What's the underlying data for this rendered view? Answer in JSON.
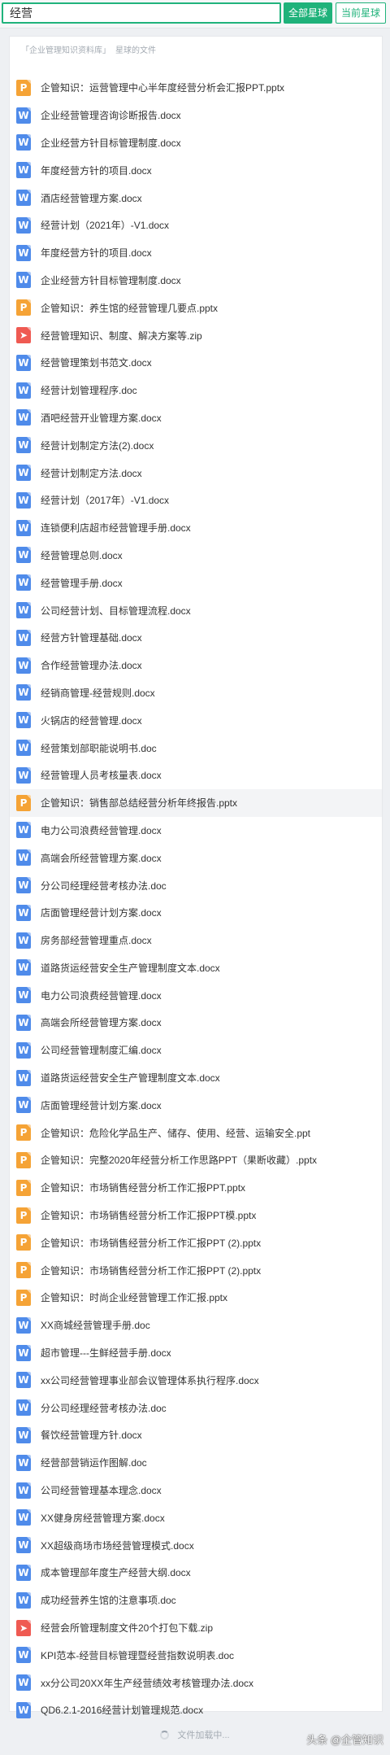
{
  "search": {
    "value": "经营",
    "all_button": "全部星球",
    "current_button": "当前星球"
  },
  "breadcrumb": {
    "items": [
      "企业管理知识资料库",
      "星球的文件"
    ],
    "prefix": "「",
    "separator": "」"
  },
  "colors": {
    "accent": "#1fb27a",
    "doc": "#4f8bea",
    "ppt": "#f5a336",
    "zip": "#ef5a52"
  },
  "files": [
    {
      "type": "ppt",
      "name": "企管知识：运营管理中心半年度经营分析会汇报PPT.pptx"
    },
    {
      "type": "doc",
      "name": "企业经营管理咨询诊断报告.docx"
    },
    {
      "type": "doc",
      "name": "企业经营方针目标管理制度.docx"
    },
    {
      "type": "doc",
      "name": "年度经营方针的项目.docx"
    },
    {
      "type": "doc",
      "name": "酒店经营管理方案.docx"
    },
    {
      "type": "doc",
      "name": "经营计划（2021年）-V1.docx"
    },
    {
      "type": "doc",
      "name": "年度经营方针的项目.docx"
    },
    {
      "type": "doc",
      "name": "企业经营方针目标管理制度.docx"
    },
    {
      "type": "ppt",
      "name": "企管知识：养生馆的经营管理几要点.pptx"
    },
    {
      "type": "zip",
      "name": "经营管理知识、制度、解决方案等.zip"
    },
    {
      "type": "doc",
      "name": "经营管理策划书范文.docx"
    },
    {
      "type": "doc",
      "name": "经营计划管理程序.doc"
    },
    {
      "type": "doc",
      "name": "酒吧经营开业管理方案.docx"
    },
    {
      "type": "doc",
      "name": "经营计划制定方法(2).docx"
    },
    {
      "type": "doc",
      "name": "经营计划制定方法.docx"
    },
    {
      "type": "doc",
      "name": "经营计划（2017年）-V1.docx"
    },
    {
      "type": "doc",
      "name": "连锁便利店超市经营管理手册.docx"
    },
    {
      "type": "doc",
      "name": "经营管理总则.docx"
    },
    {
      "type": "doc",
      "name": "经营管理手册.docx"
    },
    {
      "type": "doc",
      "name": "公司经营计划、目标管理流程.docx"
    },
    {
      "type": "doc",
      "name": "经营方针管理基础.docx"
    },
    {
      "type": "doc",
      "name": "合作经营管理办法.docx"
    },
    {
      "type": "doc",
      "name": "经销商管理-经营规则.docx"
    },
    {
      "type": "doc",
      "name": "火锅店的经营管理.docx"
    },
    {
      "type": "doc",
      "name": "经营策划部职能说明书.doc"
    },
    {
      "type": "doc",
      "name": "经营管理人员考核量表.docx"
    },
    {
      "type": "ppt",
      "name": "企管知识：销售部总结经营分析年终报告.pptx",
      "highlight": true
    },
    {
      "type": "doc",
      "name": "电力公司浪费经营管理.docx"
    },
    {
      "type": "doc",
      "name": "高端会所经营管理方案.docx"
    },
    {
      "type": "doc",
      "name": "分公司经理经营考核办法.doc"
    },
    {
      "type": "doc",
      "name": "店面管理经营计划方案.docx"
    },
    {
      "type": "doc",
      "name": "房务部经营管理重点.docx"
    },
    {
      "type": "doc",
      "name": "道路货运经营安全生产管理制度文本.docx"
    },
    {
      "type": "doc",
      "name": "电力公司浪费经营管理.docx"
    },
    {
      "type": "doc",
      "name": "高端会所经营管理方案.docx"
    },
    {
      "type": "doc",
      "name": "公司经营管理制度汇编.docx"
    },
    {
      "type": "doc",
      "name": "道路货运经营安全生产管理制度文本.docx"
    },
    {
      "type": "doc",
      "name": "店面管理经营计划方案.docx"
    },
    {
      "type": "ppt",
      "name": "企管知识：危险化学品生产、储存、使用、经营、运输安全.ppt"
    },
    {
      "type": "ppt",
      "name": "企管知识：完整2020年经营分析工作思路PPT（果断收藏）.pptx"
    },
    {
      "type": "ppt",
      "name": "企管知识：市场销售经营分析工作汇报PPT.pptx"
    },
    {
      "type": "ppt",
      "name": "企管知识：市场销售经营分析工作汇报PPT模.pptx"
    },
    {
      "type": "ppt",
      "name": "企管知识：市场销售经营分析工作汇报PPT (2).pptx"
    },
    {
      "type": "ppt",
      "name": "企管知识：市场销售经营分析工作汇报PPT (2).pptx"
    },
    {
      "type": "ppt",
      "name": "企管知识：时尚企业经营管理工作汇报.pptx"
    },
    {
      "type": "doc",
      "name": "XX商城经营管理手册.doc"
    },
    {
      "type": "doc",
      "name": "超市管理---生鲜经营手册.docx"
    },
    {
      "type": "doc",
      "name": "xx公司经营管理事业部会议管理体系执行程序.docx"
    },
    {
      "type": "doc",
      "name": "分公司经理经营考核办法.doc"
    },
    {
      "type": "doc",
      "name": "餐饮经营管理方针.docx"
    },
    {
      "type": "doc",
      "name": "经营部营销运作图解.doc"
    },
    {
      "type": "doc",
      "name": "公司经营管理基本理念.docx"
    },
    {
      "type": "doc",
      "name": "XX健身房经营管理方案.docx"
    },
    {
      "type": "doc",
      "name": "XX超级商场市场经营管理模式.docx"
    },
    {
      "type": "doc",
      "name": "成本管理部年度生产经营大纲.docx"
    },
    {
      "type": "doc",
      "name": "成功经营养生馆的注意事项.doc"
    },
    {
      "type": "zip",
      "name": "经营会所管理制度文件20个打包下载.zip"
    },
    {
      "type": "doc",
      "name": "KPI范本-经营目标管理暨经营指数说明表.doc"
    },
    {
      "type": "doc",
      "name": "xx分公司20XX年生产经营绩效考核管理办法.docx"
    },
    {
      "type": "doc",
      "name": "QD6.2.1-2016经营计划管理规范.docx"
    }
  ],
  "footer": {
    "loading_text": "文件加载中...",
    "watermark": "头条 @企管知识"
  }
}
